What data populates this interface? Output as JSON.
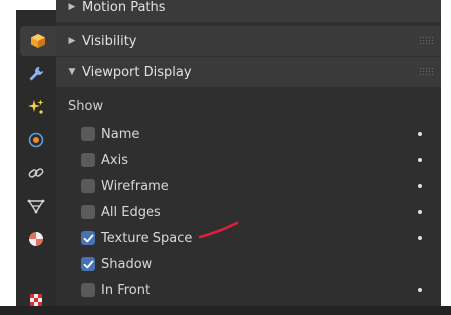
{
  "sidebar": {
    "tabs": [
      {
        "icon": "object-cube-icon",
        "active": true
      },
      {
        "icon": "wrench-modifier-icon"
      },
      {
        "icon": "particles-sparkle-icon"
      },
      {
        "icon": "physics-orbit-icon"
      },
      {
        "icon": "constraint-link-icon"
      },
      {
        "icon": "object-data-mesh-icon"
      },
      {
        "icon": "material-sphere-icon"
      },
      {
        "icon": "texture-checker-icon"
      }
    ]
  },
  "panels": {
    "motion_paths": {
      "label": "Motion Paths",
      "collapsed": true
    },
    "visibility": {
      "label": "Visibility",
      "collapsed": true
    },
    "viewport_display": {
      "label": "Viewport Display",
      "collapsed": false
    }
  },
  "show": {
    "label": "Show",
    "items": [
      {
        "label": "Name",
        "checked": false,
        "keyframe_dot": true
      },
      {
        "label": "Axis",
        "checked": false,
        "keyframe_dot": true
      },
      {
        "label": "Wireframe",
        "checked": false,
        "keyframe_dot": true
      },
      {
        "label": "All Edges",
        "checked": false,
        "keyframe_dot": true
      },
      {
        "label": "Texture Space",
        "checked": true,
        "keyframe_dot": true
      },
      {
        "label": "Shadow",
        "checked": true,
        "keyframe_dot": false
      },
      {
        "label": "In Front",
        "checked": false,
        "keyframe_dot": true
      }
    ]
  },
  "colors": {
    "accent_checkbox": "#4772b3",
    "annotation_red": "#e0203a"
  }
}
